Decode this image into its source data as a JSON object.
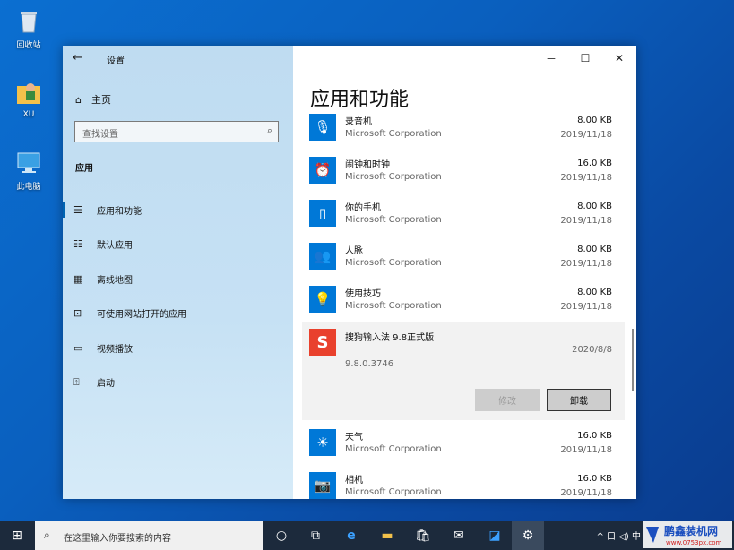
{
  "desktop": {
    "icons": [
      {
        "label": "回收站",
        "icon": "recycle-bin-icon"
      },
      {
        "label": "XU",
        "icon": "user-folder-icon"
      },
      {
        "label": "此电脑",
        "icon": "computer-icon"
      }
    ]
  },
  "window": {
    "title": "设置",
    "controls": {
      "minimize": "－",
      "maximize": "☐",
      "close": "✕"
    }
  },
  "sidebar": {
    "home": "主页",
    "search_placeholder": "查找设置",
    "section": "应用",
    "items": [
      {
        "label": "应用和功能",
        "icon": "list-icon",
        "active": true
      },
      {
        "label": "默认应用",
        "icon": "default-apps-icon"
      },
      {
        "label": "离线地图",
        "icon": "map-icon"
      },
      {
        "label": "可使用网站打开的应用",
        "icon": "open-web-icon"
      },
      {
        "label": "视频播放",
        "icon": "video-icon"
      },
      {
        "label": "启动",
        "icon": "startup-icon"
      }
    ]
  },
  "main": {
    "title": "应用和功能",
    "apps": [
      {
        "name": "录音机",
        "publisher": "Microsoft Corporation",
        "size": "8.00 KB",
        "date": "2019/11/18",
        "icon": "microphone-icon"
      },
      {
        "name": "闹钟和时钟",
        "publisher": "Microsoft Corporation",
        "size": "16.0 KB",
        "date": "2019/11/18",
        "icon": "alarm-clock-icon"
      },
      {
        "name": "你的手机",
        "publisher": "Microsoft Corporation",
        "size": "8.00 KB",
        "date": "2019/11/18",
        "icon": "phone-icon"
      },
      {
        "name": "人脉",
        "publisher": "Microsoft Corporation",
        "size": "8.00 KB",
        "date": "2019/11/18",
        "icon": "people-icon"
      },
      {
        "name": "使用技巧",
        "publisher": "Microsoft Corporation",
        "size": "8.00 KB",
        "date": "2019/11/18",
        "icon": "lightbulb-icon"
      }
    ],
    "selected_app": {
      "name": "搜狗输入法 9.8正式版",
      "date": "2020/8/8",
      "version": "9.8.0.3746",
      "modify_label": "修改",
      "uninstall_label": "卸载",
      "icon": "sogou-icon"
    },
    "apps_after": [
      {
        "name": "天气",
        "publisher": "Microsoft Corporation",
        "size": "16.0 KB",
        "date": "2019/11/18",
        "icon": "weather-icon"
      },
      {
        "name": "相机",
        "publisher": "Microsoft Corporation",
        "size": "16.0 KB",
        "date": "2019/11/18",
        "icon": "camera-icon"
      }
    ]
  },
  "taskbar": {
    "search_placeholder": "在这里输入你要搜索的内容",
    "tray_text": "^ 口 ◁) 中",
    "watermark": "鹏鑫装机网 www.0753px.com"
  }
}
